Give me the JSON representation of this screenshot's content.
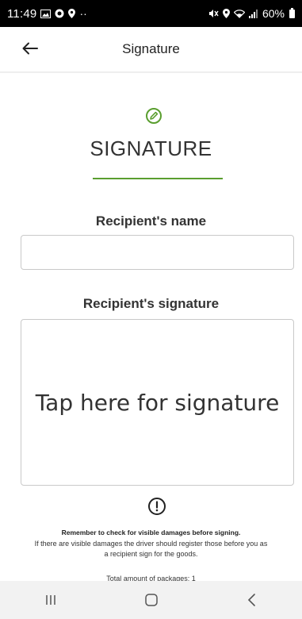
{
  "status_bar": {
    "time": "11:49",
    "battery": "60%",
    "dots": "··"
  },
  "app_bar": {
    "title": "Signature"
  },
  "header": {
    "heading": "SIGNATURE",
    "accent_color": "#5a9e2f"
  },
  "form": {
    "name_label": "Recipient's name",
    "name_value": "",
    "signature_label": "Recipient's signature",
    "signature_placeholder": "Tap here for signature"
  },
  "notice": {
    "bold_text": "Remember to check for visible damages before signing.",
    "body_text": "If there are visible damages the driver should register those before you as a recipient sign for the goods.",
    "packages_text": "Total amount of packages: 1"
  },
  "icons": {
    "back": "arrow-left-icon",
    "pencil": "pencil-circle-icon",
    "alert": "exclamation-circle-icon"
  }
}
